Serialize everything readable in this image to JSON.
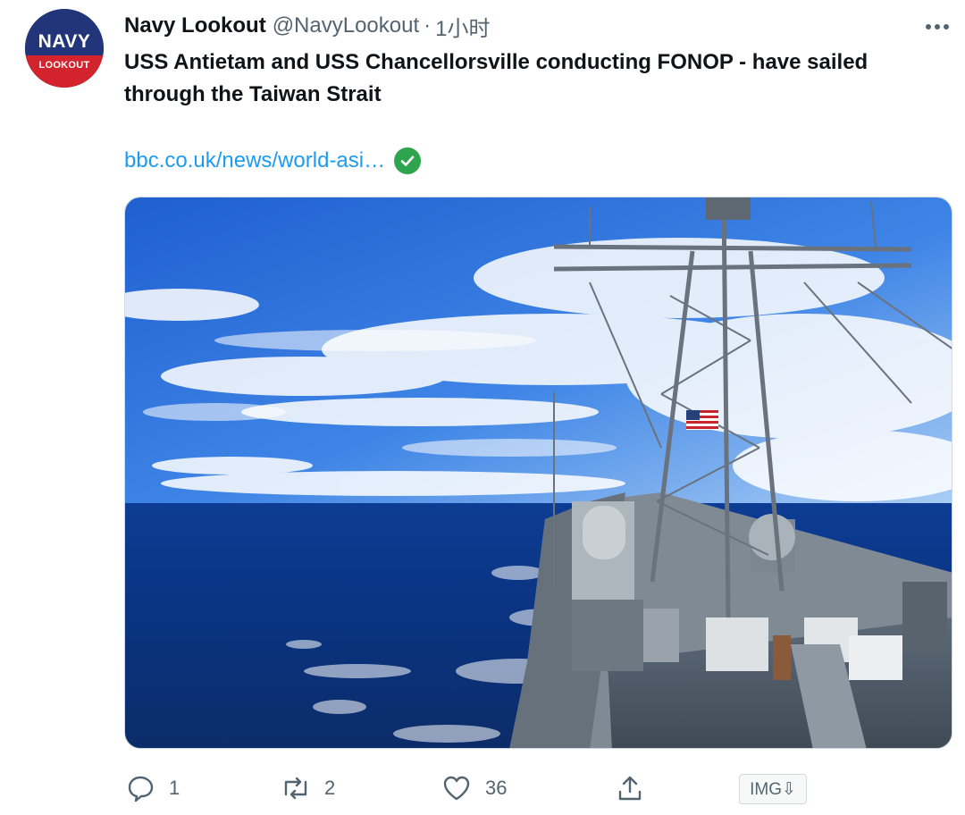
{
  "author": {
    "display_name": "Navy Lookout",
    "handle": "@NavyLookout",
    "separator": "·",
    "timestamp": "1小时",
    "avatar": {
      "top_text": "NAVY",
      "bottom_text": "LOOKOUT"
    }
  },
  "tweet": {
    "text": "USS Antietam and USS Chancellorsville conducting FONOP - have sailed through the Taiwan Strait",
    "link_text": "bbc.co.uk/news/world-asi…"
  },
  "actions": {
    "replies": "1",
    "retweets": "2",
    "likes": "36",
    "image_button": "IMG⇩"
  },
  "colors": {
    "link": "#1d9bf0",
    "muted": "#536471",
    "verified_check": "#2ea44f",
    "avatar_blue": "#23357a",
    "avatar_red": "#d3232d"
  },
  "icons": [
    "more-icon",
    "verified-check-icon",
    "reply-icon",
    "retweet-icon",
    "like-icon",
    "share-icon"
  ]
}
